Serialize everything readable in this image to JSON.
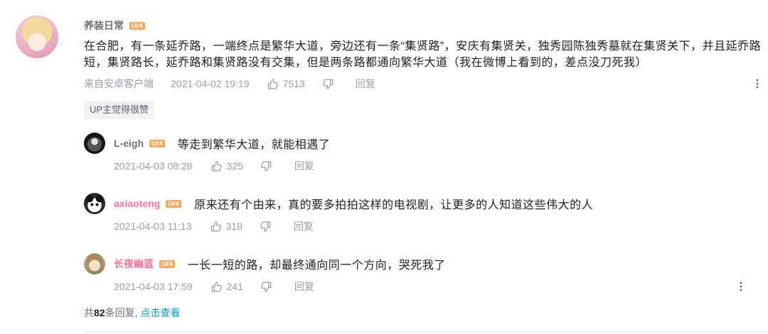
{
  "colors": {
    "text": "#222222",
    "meta": "#99a2aa",
    "username": "#6d757a",
    "vip_username": "#fb7299",
    "level_badge": "#ffa759",
    "link": "#00a1d6",
    "divider": "#e5e9ef"
  },
  "icons": {
    "like": "thumbs-up-icon",
    "dislike": "thumbs-down-icon",
    "more": "more-vertical-icon"
  },
  "comment": {
    "avatar_icon": "anime-girl-avatar",
    "username": "养装日常",
    "name_color": "#6d757a",
    "level": "LV4",
    "text": "在合肥，有一条延乔路，一端终点是繁华大道，旁边还有一条“集贤路”，安庆有集贤关，独秀园陈独秀墓就在集贤关下，并且延乔路短，集贤路长，延乔路和集贤路没有交集，但是两条路都通向繁华大道（我在微博上看到的，差点没刀死我）",
    "source": "来自安卓客户端",
    "time": "2021-04-02 19:19",
    "likes": "7513",
    "reply_label": "回复",
    "up_tag": "UP主觉得很赞"
  },
  "replies": [
    {
      "avatar_icon": "dark-portrait-avatar",
      "username": "L-eigh",
      "name_color": "#6d757a",
      "level": "LV4",
      "text": "等走到繁华大道，就能相遇了",
      "time": "2021-04-03 08:28",
      "likes": "325",
      "reply_label": "回复"
    },
    {
      "avatar_icon": "panda-avatar",
      "username": "axiaoteng",
      "name_color": "#fb7299",
      "level": "LV4",
      "text": "原来还有个由来，真的要多拍拍这样的电视剧，让更多的人知道这些伟大的人",
      "time": "2021-04-03 11:13",
      "likes": "318",
      "reply_label": "回复"
    },
    {
      "avatar_icon": "beige-portrait-avatar",
      "username": "长夜幽蓝",
      "name_color": "#fb7299",
      "level": "LV4",
      "text": "一长一短的路，却最终通向同一个方向，哭死我了",
      "time": "2021-04-03 17:59",
      "likes": "241",
      "reply_label": "回复"
    }
  ],
  "footer": {
    "prefix": "共",
    "count": "82",
    "suffix": "条回复,",
    "link": "点击查看"
  }
}
